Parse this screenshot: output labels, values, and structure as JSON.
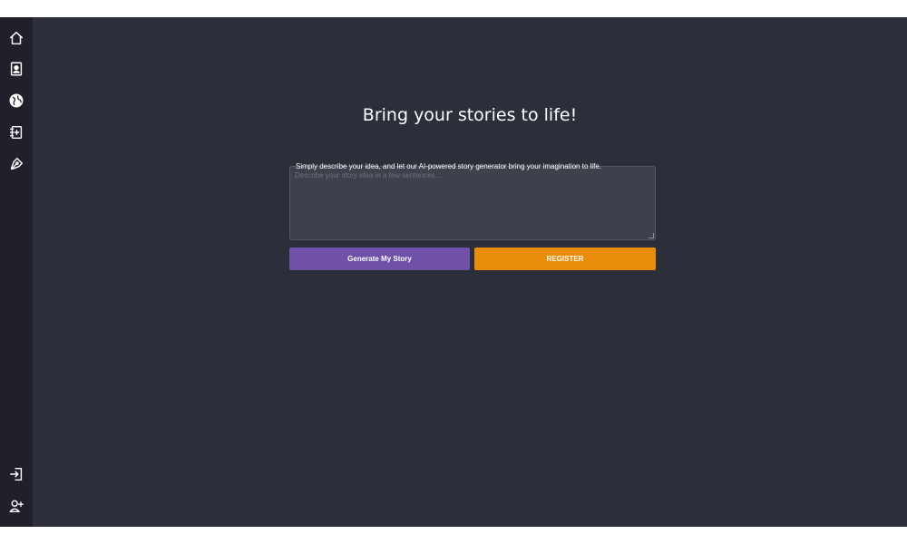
{
  "sidebar": {
    "top_items": [
      {
        "icon": "home-icon"
      },
      {
        "icon": "id-card-icon"
      },
      {
        "icon": "globe-icon"
      },
      {
        "icon": "notebook-add-icon"
      },
      {
        "icon": "pen-tool-icon"
      }
    ],
    "bottom_items": [
      {
        "icon": "login-icon"
      },
      {
        "icon": "add-user-icon"
      }
    ]
  },
  "main": {
    "title": "Bring your stories to life!",
    "story_input": {
      "label": "Simply describe your idea, and let our AI-powered story generator bring your imagination to life.",
      "placeholder": "Describe your story idea in a few sentences...",
      "value": ""
    },
    "buttons": {
      "generate": "Generate My Story",
      "register": "REGISTER"
    }
  },
  "colors": {
    "sidebar_bg": "#1f2029",
    "main_bg": "#2c2e39",
    "generate_button": "#6f51a9",
    "register_button": "#e88c0a"
  }
}
